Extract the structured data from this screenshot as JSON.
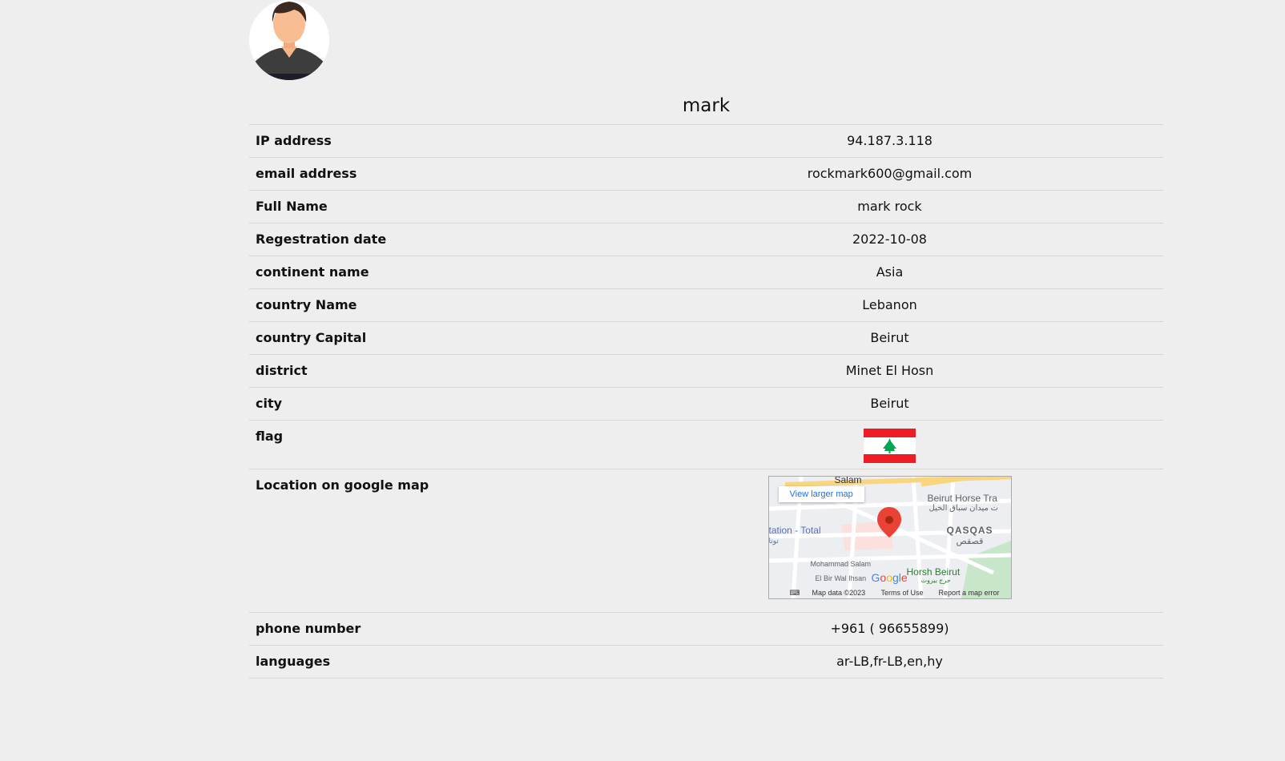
{
  "profile": {
    "username": "mark",
    "avatar_icon": "user-avatar-icon"
  },
  "rows": [
    {
      "label": "IP address",
      "value": "94.187.3.118"
    },
    {
      "label": "email address",
      "value": "rockmark600@gmail.com"
    },
    {
      "label": "Full Name",
      "value": "mark rock"
    },
    {
      "label": "Regestration date",
      "value": "2022-10-08"
    },
    {
      "label": "continent name",
      "value": "Asia"
    },
    {
      "label": "country Name",
      "value": "Lebanon"
    },
    {
      "label": "country Capital",
      "value": "Beirut"
    },
    {
      "label": "district",
      "value": "Minet El Hosn"
    },
    {
      "label": "city",
      "value": "Beirut"
    }
  ],
  "flag": {
    "label": "flag",
    "icon": "lebanon-flag-icon",
    "colors": {
      "red": "#ee1c25",
      "white": "#ffffff",
      "cedar": "#00a651"
    }
  },
  "map": {
    "label": "Location on google map",
    "view_larger": "View larger map",
    "places": {
      "salam": "Salam",
      "horse": "Beirut Horse Tra",
      "horse_ar": "ت ميدان سباق الخيل",
      "station": "tation - Total",
      "station_ar": "توتا",
      "qasqas": "QASQAS",
      "qasqas_ar": "قصقص",
      "mohammad": "Mohammad Salam",
      "bir": "El Bir Wal Ihsan",
      "horsh": "Horsh Beirut",
      "horsh_ar": "حرج بيروت"
    },
    "logo": "Google",
    "map_data": "Map data ©2023",
    "terms": "Terms of Use",
    "report": "Report a map error"
  },
  "bottom_rows": [
    {
      "label": "phone number",
      "value": "+961 ( 96655899)"
    },
    {
      "label": "languages",
      "value": "ar-LB,fr-LB,en,hy"
    }
  ]
}
